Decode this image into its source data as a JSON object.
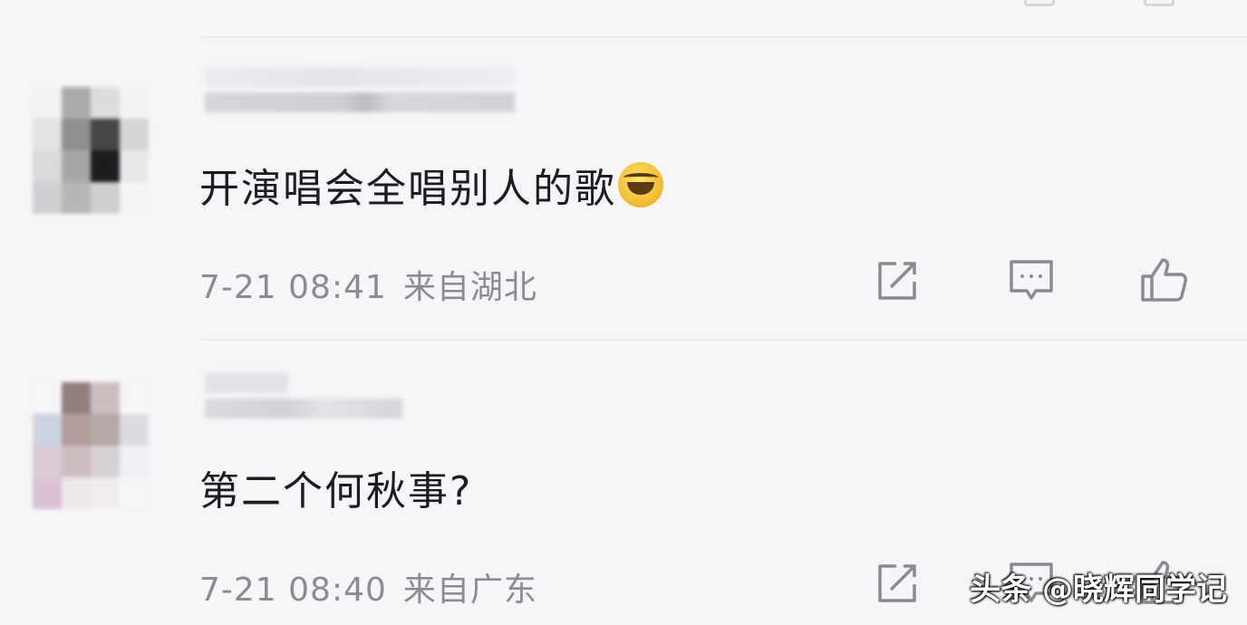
{
  "comments": [
    {
      "text": "开演唱会全唱别人的歌",
      "emoji": "laughing-crying-emoji",
      "time": "7-21 08:41",
      "location": "来自湖北"
    },
    {
      "text": "第二个何秋事?",
      "time": "7-21 08:40",
      "location": "来自广东"
    }
  ],
  "icons": {
    "repost": "share-icon",
    "comment": "comment-icon",
    "like": "thumbs-up-icon"
  },
  "watermark": "头条 @晓辉同学记",
  "colors": {
    "background": "#f6f5f8",
    "text": "#1d1c22",
    "meta": "#8c8a94",
    "icon": "#8c8a94"
  }
}
